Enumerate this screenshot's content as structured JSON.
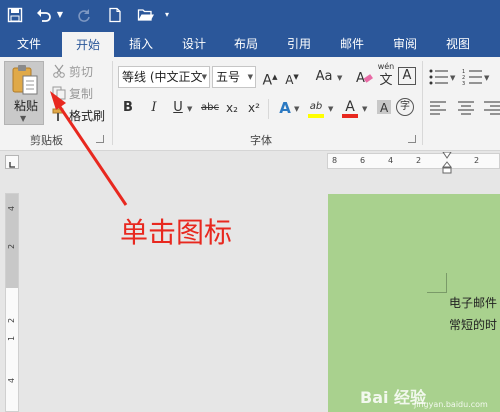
{
  "colors": {
    "ribbon_blue": "#2b579a",
    "ribbon_bg": "#f3f3f3",
    "page_green": "#a9d18e",
    "annotation_red": "#e8281f",
    "highlight_yellow": "#ffff00",
    "font_color_red": "#e8281f"
  },
  "quick_access": {
    "icons": [
      "save-icon",
      "undo-icon",
      "redo-icon",
      "new-document-icon",
      "open-folder-icon",
      "customize-icon"
    ]
  },
  "tabs": [
    {
      "label": "文件",
      "active": false
    },
    {
      "label": "开始",
      "active": true
    },
    {
      "label": "插入",
      "active": false
    },
    {
      "label": "设计",
      "active": false
    },
    {
      "label": "布局",
      "active": false
    },
    {
      "label": "引用",
      "active": false
    },
    {
      "label": "邮件",
      "active": false
    },
    {
      "label": "审阅",
      "active": false
    },
    {
      "label": "视图",
      "active": false
    }
  ],
  "clipboard": {
    "paste_label": "粘贴",
    "cut_label": "剪切",
    "copy_label": "复制",
    "format_painter_label": "格式刷",
    "group_label": "剪贴板"
  },
  "font": {
    "font_name": "等线 (中文正文",
    "font_size": "五号",
    "change_case": "Aa",
    "phonetic_top": "wén",
    "phonetic_char": "文",
    "border_char": "A",
    "group_label": "字体",
    "bold": "B",
    "italic": "I",
    "underline": "U",
    "strikethrough": "abc",
    "subscript": "x₂",
    "superscript": "x²",
    "highlight": "ab",
    "font_color": "A",
    "enclose_char": "字"
  },
  "ruler": {
    "h_numbers": [
      "8",
      "6",
      "4",
      "2",
      "2"
    ],
    "v_numbers": [
      "4",
      "2",
      "2",
      "1",
      "4"
    ]
  },
  "document": {
    "lines": [
      "电子邮件",
      "常短的时"
    ]
  },
  "annotation": "单击图标",
  "watermark": {
    "main": "Bai 经验",
    "sub": "jingyan.baidu.com"
  }
}
